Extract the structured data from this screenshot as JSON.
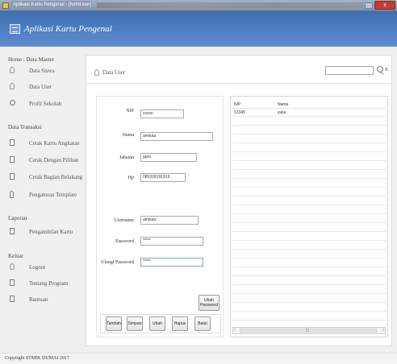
{
  "window": {
    "title": "Aplikasi Kartu Pengenal - [formUser]",
    "minimize_icon": "minimize-icon",
    "close_label": "x"
  },
  "header": {
    "app_name": "Aplikasi Kartu Pengenal",
    "logo_icon": "id-card-icon",
    "color": "#4a78bd"
  },
  "sidebar": {
    "groups": [
      {
        "title": "Home : Data Master",
        "items": [
          {
            "label": "Data Siswa",
            "icon": "user-icon"
          },
          {
            "label": "Data User",
            "icon": "user-icon"
          },
          {
            "label": "Profil Sekolah",
            "icon": "settings-icon"
          }
        ]
      },
      {
        "title": "Data Transaksi",
        "items": [
          {
            "label": "Cetak Kartu Angkatan",
            "icon": "printer-icon"
          },
          {
            "label": "Cetak Dengan Pilihan",
            "icon": "printer-icon"
          },
          {
            "label": "Cetak Bagian Belakang",
            "icon": "printer-icon"
          },
          {
            "label": "Pengaturan Template",
            "icon": "pin-icon"
          }
        ]
      },
      {
        "title": "Laporan",
        "items": [
          {
            "label": "Pengambilan Kartu",
            "icon": "document-icon"
          }
        ]
      },
      {
        "title": "Keluar",
        "items": [
          {
            "label": "Logout",
            "icon": "user-icon"
          },
          {
            "label": "Tentang Program",
            "icon": "document-icon"
          },
          {
            "label": "Bantuan",
            "icon": "help-document-icon"
          }
        ]
      }
    ]
  },
  "main": {
    "breadcrumb": "Data User",
    "search": {
      "value": "",
      "clear_label": "x"
    },
    "form": {
      "nip": {
        "label": "NIP",
        "value": "xxxxx"
      },
      "nama": {
        "label": "Nama",
        "value": "amisaa"
      },
      "jabatan": {
        "label": "Jabatan",
        "value": "guru"
      },
      "hp": {
        "label": "Hp",
        "value": "085209191919"
      },
      "username": {
        "label": "Username",
        "value": "amisaa"
      },
      "password": {
        "label": "Password",
        "value": "*****"
      },
      "ulangi_password": {
        "label": "Ulangi Password",
        "value": "*****"
      }
    },
    "buttons": {
      "ubah_password": "Ubah Password",
      "tambah": "Tambah",
      "simpan": "Simpan",
      "ubah": "Ubah",
      "hapus": "Hapus",
      "batal": "Batal"
    },
    "table": {
      "columns": [
        "NIP",
        "Nama"
      ],
      "rows": [
        [
          "12345",
          "yulia"
        ]
      ]
    }
  },
  "footer": {
    "copyright": "Copyright STMIK DUMAI 2017"
  }
}
